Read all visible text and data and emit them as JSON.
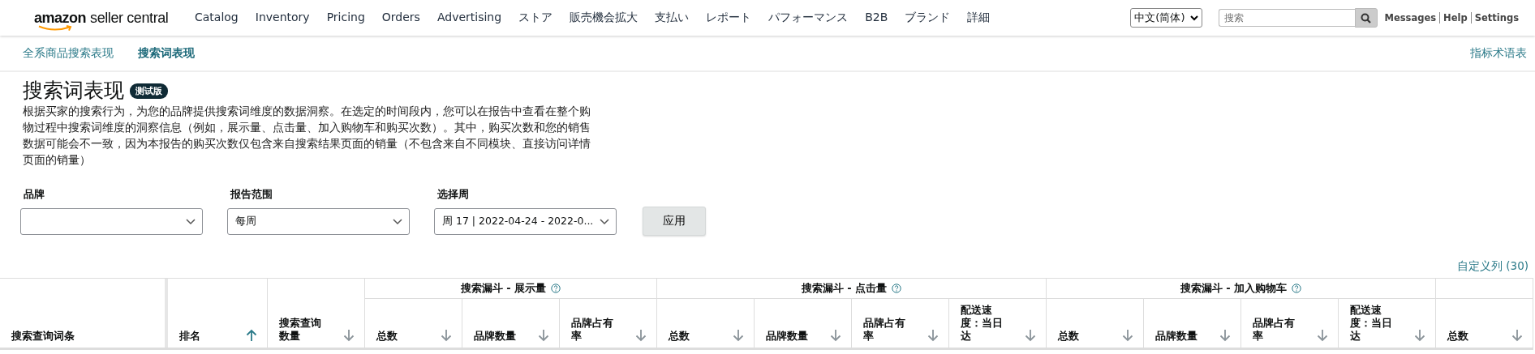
{
  "nav": {
    "logo_brand": "amazon",
    "logo_product": "seller central",
    "items": [
      "Catalog",
      "Inventory",
      "Pricing",
      "Orders",
      "Advertising",
      "ストア",
      "販売機会拡大",
      "支払い",
      "レポート",
      "パフォーマンス",
      "B2B",
      "ブランド",
      "詳細"
    ],
    "language": "中文(简体)",
    "search": {
      "placeholder": "搜索"
    },
    "links": [
      "Messages",
      "Help",
      "Settings"
    ]
  },
  "subnav": {
    "tabs": [
      {
        "label": "全系商品搜索表现",
        "selected": false
      },
      {
        "label": "搜索词表现",
        "selected": true
      }
    ],
    "glossary": "指标术语表"
  },
  "page": {
    "title": "搜索词表现",
    "badge": "测试版",
    "description": "根据买家的搜索行为，为您的品牌提供搜索词维度的数据洞察。在选定的时间段内，您可以在报告中查看在整个购物过程中搜索词维度的洞察信息（例如，展示量、点击量、加入购物车和购买次数）。其中，购买次数和您的销售数据可能会不一致，因为本报告的购买次数仅包含来自搜索结果页面的销量（不包含来自不同模块、直接访问详情页面的销量）"
  },
  "filters": [
    {
      "label": "品牌"
    },
    {
      "label": "报告范围",
      "value": "每周"
    },
    {
      "label": "选择周",
      "value": "周 17 | 2022-04-24 - 2022-0..."
    }
  ],
  "apply_button": "应用",
  "customize_columns": "自定义列 (30)",
  "table": {
    "columns": [
      {
        "label": "搜索查询词条"
      },
      {
        "label": "排名",
        "sort_ascending": true
      },
      {
        "label": "搜索查询数量",
        "sort_ascending": false
      }
    ],
    "groups": [
      {
        "label": "搜索漏斗 - 展示量",
        "columns": [
          {
            "label": "总数",
            "sort_ascending": false
          },
          {
            "label": "品牌数量",
            "sort_ascending": false
          },
          {
            "label": "品牌占有率",
            "sort_ascending": false
          }
        ]
      },
      {
        "label": "搜索漏斗 - 点击量",
        "columns": [
          {
            "label": "总数",
            "sort_ascending": false
          },
          {
            "label": "品牌数量",
            "sort_ascending": false
          },
          {
            "label": "品牌占有率",
            "sort_ascending": false
          },
          {
            "label": "配送速度：当日达",
            "sort_ascending": false
          }
        ]
      },
      {
        "label": "搜索漏斗 - 加入购物车",
        "columns": [
          {
            "label": "总数",
            "sort_ascending": false
          },
          {
            "label": "品牌数量",
            "sort_ascending": false
          },
          {
            "label": "品牌占有率",
            "sort_ascending": false
          },
          {
            "label": "配送速度：当日达",
            "sort_ascending": false
          }
        ]
      },
      {
        "columns": [
          {
            "label": "总数",
            "sort_ascending": false
          }
        ]
      }
    ]
  }
}
